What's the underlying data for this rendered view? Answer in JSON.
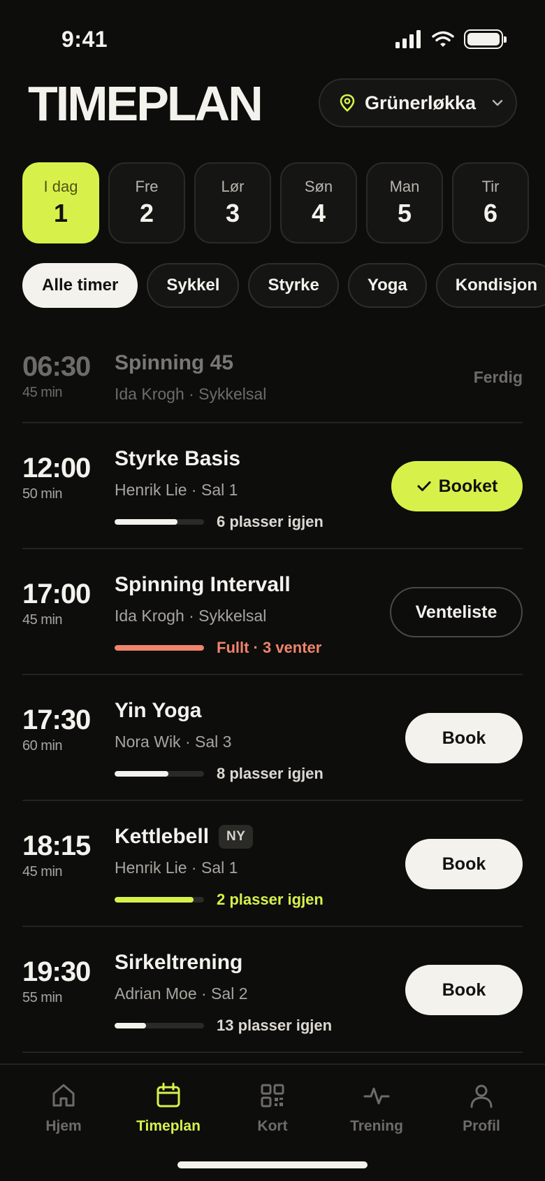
{
  "status": {
    "time": "9:41"
  },
  "header": {
    "title": "TIMEPLAN",
    "location": "Grünerløkka"
  },
  "days": [
    {
      "label": "I dag",
      "num": "1",
      "active": true
    },
    {
      "label": "Fre",
      "num": "2"
    },
    {
      "label": "Lør",
      "num": "3"
    },
    {
      "label": "Søn",
      "num": "4"
    },
    {
      "label": "Man",
      "num": "5"
    },
    {
      "label": "Tir",
      "num": "6"
    }
  ],
  "filters": [
    "Alle timer",
    "Sykkel",
    "Styrke",
    "Yoga",
    "Kondisjon"
  ],
  "classes": [
    {
      "time": "06:30",
      "duration": "45 min",
      "name": "Spinning 45",
      "meta": "Ida Krogh · Sykkelsal",
      "status": "Ferdig"
    },
    {
      "time": "12:00",
      "duration": "50 min",
      "name": "Styrke Basis",
      "meta": "Henrik Lie · Sal 1",
      "capacity_text": "6 plasser igjen",
      "fill": 0.7,
      "action": "Booket"
    },
    {
      "time": "17:00",
      "duration": "45 min",
      "name": "Spinning Intervall",
      "meta": "Ida Krogh · Sykkelsal",
      "capacity_text": "Fullt · 3 venter",
      "fill": 1.0,
      "action": "Venteliste"
    },
    {
      "time": "17:30",
      "duration": "60 min",
      "name": "Yin Yoga",
      "meta": "Nora Wik · Sal 3",
      "capacity_text": "8 plasser igjen",
      "fill": 0.6,
      "action": "Book"
    },
    {
      "time": "18:15",
      "duration": "45 min",
      "name": "Kettlebell",
      "badge": "NY",
      "meta": "Henrik Lie · Sal 1",
      "capacity_text": "2 plasser igjen",
      "fill": 0.88,
      "action": "Book"
    },
    {
      "time": "19:30",
      "duration": "55 min",
      "name": "Sirkeltrening",
      "meta": "Adrian Moe · Sal 2",
      "capacity_text": "13 plasser igjen",
      "fill": 0.35,
      "action": "Book"
    }
  ],
  "tabs": [
    {
      "label": "Hjem",
      "icon": "home-icon"
    },
    {
      "label": "Timeplan",
      "icon": "calendar-icon",
      "active": true
    },
    {
      "label": "Kort",
      "icon": "qr-code-icon"
    },
    {
      "label": "Trening",
      "icon": "activity-icon"
    },
    {
      "label": "Profil",
      "icon": "user-icon"
    }
  ],
  "colors": {
    "accent": "#d8f14a",
    "full": "#f0846a",
    "background": "#0d0d0c",
    "light": "#f4f2ec"
  }
}
